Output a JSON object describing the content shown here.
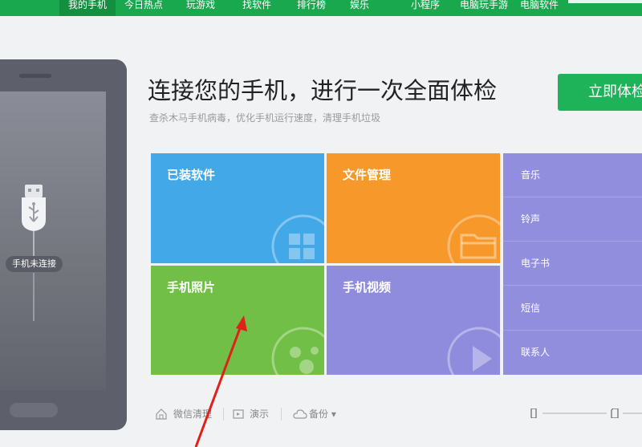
{
  "nav": {
    "items": [
      "我的手机",
      "今日热点",
      "玩游戏",
      "找软件",
      "排行榜",
      "娱乐",
      "小程序",
      "电脑玩手游",
      "电脑软件"
    ],
    "active_index": 0
  },
  "phone": {
    "status_label": "手机未连接"
  },
  "header": {
    "title": "连接您的手机，进行一次全面体检",
    "subtitle": "查杀木马手机病毒，优化手机运行速度，清理手机垃圾",
    "check_button": "立即体检"
  },
  "tiles": {
    "installed_apps": "已装软件",
    "file_manager": "文件管理",
    "photos": "手机照片",
    "videos": "手机视频"
  },
  "media_list": [
    "音乐",
    "铃声",
    "电子书",
    "短信",
    "联系人"
  ],
  "bottom_bar": {
    "wechat_clean": "微信清理",
    "demo": "演示",
    "backup": "备份"
  },
  "colors": {
    "nav_green": "#1aa84f",
    "button_green": "#1fb359",
    "tile_blue": "#42a8e8",
    "tile_orange": "#f7992a",
    "tile_green": "#71bf46",
    "tile_purple": "#8f8cdd",
    "annotation_red": "#e0201b"
  },
  "icons": [
    "usb-plug-icon",
    "apps-grid-icon",
    "folder-icon",
    "photo-icon",
    "play-icon",
    "home-clean-icon",
    "demo-icon",
    "cloud-icon",
    "phone-small-icon",
    "sd-card-icon"
  ]
}
